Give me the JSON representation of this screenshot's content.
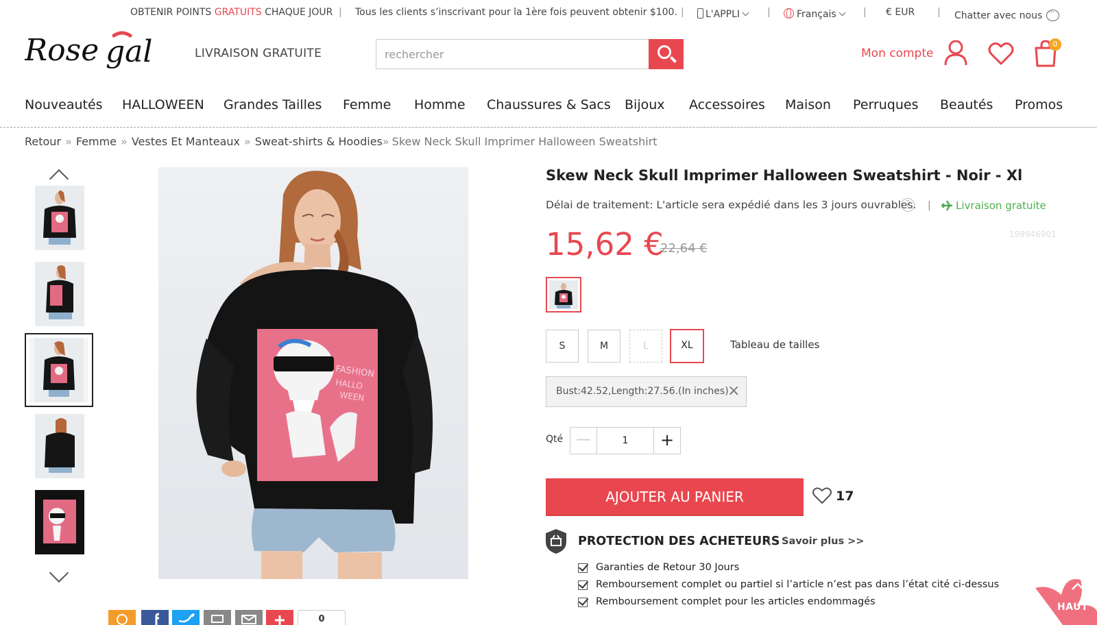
{
  "topbar": {
    "promo_prefix": "OBTENIR POINTS ",
    "promo_highlight": "GRATUITS",
    "promo_suffix": " CHAQUE JOUR",
    "new_customer": "Tous les clients s’inscrivant pour la 1ère fois peuvent obtenir $100.",
    "app": "L'APPLI",
    "language": "Français",
    "currency": "€ EUR",
    "chat": "Chatter avec nous"
  },
  "header": {
    "logo_text": "Rosegal",
    "free_shipping": "LIVRAISON GRATUITE",
    "search_placeholder": "rechercher",
    "account_label": "Mon compte",
    "cart_count": "0"
  },
  "nav": {
    "items": [
      "Nouveautés",
      "HALLOWEEN",
      "Grandes Tailles",
      "Femme",
      "Homme",
      "Chaussures & Sacs",
      "Bijoux",
      "Accessoires",
      "Maison",
      "Perruques",
      "Beautés",
      "Promos"
    ]
  },
  "breadcrumb": {
    "items": [
      "Retour",
      "Femme",
      "Vestes Et Manteaux",
      "Sweat-shirts & Hoodies"
    ],
    "separator": "»",
    "current": "Skew Neck Skull Imprimer Halloween Sweatshirt"
  },
  "gallery": {
    "thumbnail_count": 5,
    "active_index": 2
  },
  "product": {
    "title": "Skew Neck Skull Imprimer Halloween Sweatshirt - Noir - Xl",
    "delay": "Délai de traitement: L'article sera expédié dans les 3 jours ouvrables.",
    "help": "?",
    "free_shipping": "Livraison gratuite",
    "sku": "198946901",
    "price": "15,62 €",
    "old_price": "22,64 €",
    "sizes": [
      {
        "label": "S",
        "state": "available"
      },
      {
        "label": "M",
        "state": "available"
      },
      {
        "label": "L",
        "state": "disabled"
      },
      {
        "label": "XL",
        "state": "selected"
      }
    ],
    "size_chart": "Tableau de tailles",
    "size_info": "Bust:42.52,Length:27.56.(In inches)",
    "qty_label": "Qté",
    "qty_value": "1",
    "add_to_cart": "AJOUTER AU PANIER",
    "wishlist_count": "17"
  },
  "protection": {
    "title": "PROTECTION DES ACHETEURS",
    "more": "Savoir plus >>",
    "items": [
      "Garanties de Retour 30 Jours",
      "Remboursement complet ou partiel si l’article n’est pas dans l’état cité ci-dessus",
      "Remboursement complet pour les articles endommagés"
    ]
  },
  "share": {
    "count": "0"
  },
  "back_to_top": "HAUT",
  "colors": {
    "accent": "#e8474f",
    "green": "#4caf50",
    "badge": "#f5a623"
  }
}
